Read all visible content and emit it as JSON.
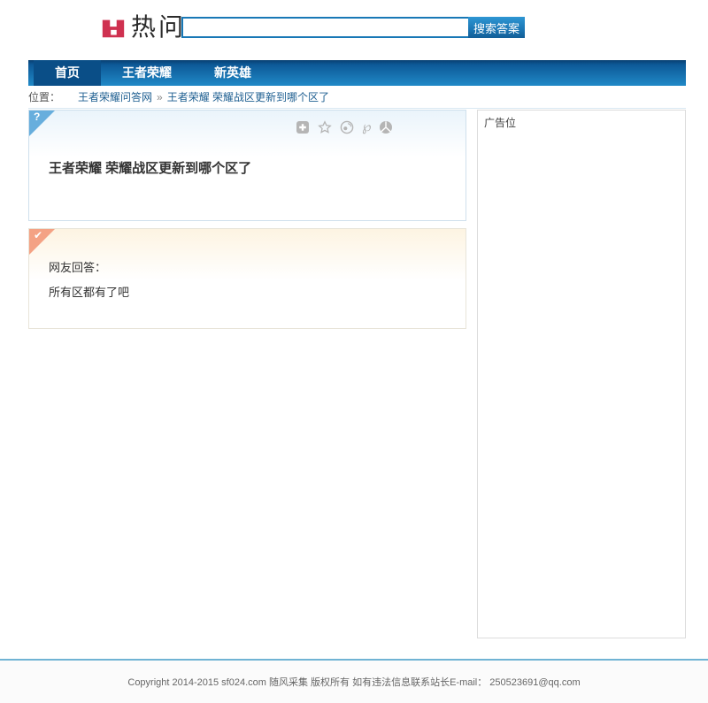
{
  "header": {
    "logo_text": "热问",
    "search_value": "",
    "search_button": "搜索答案"
  },
  "nav": {
    "items": [
      {
        "label": "首页",
        "active": true
      },
      {
        "label": "王者荣耀",
        "active": false
      },
      {
        "label": "新英雄",
        "active": false
      }
    ]
  },
  "breadcrumb": {
    "label": "位置：",
    "site": "王者荣耀问答网",
    "separator": "»",
    "current": "王者荣耀 荣耀战区更新到哪个区了"
  },
  "question": {
    "corner_glyph": "?",
    "title": "王者荣耀 荣耀战区更新到哪个区了",
    "share_icons": [
      "share-plus-icon",
      "favorite-star-icon",
      "sina-weibo-icon",
      "tencent-weibo-icon",
      "qzone-icon"
    ],
    "tencent_glyph": "℘"
  },
  "answer": {
    "corner_glyph": "✔",
    "heading": "网友回答：",
    "body": "所有区都有了吧"
  },
  "sidebar": {
    "ad_label": "广告位"
  },
  "footer": {
    "copyright": "Copyright 2014-2015 sf024.com 随风采集 版权所有 如有违法信息联系站长E-mail： 250523691@qq.com"
  },
  "colors": {
    "brand_red": "#cf3150",
    "accent_blue": "#1878b6",
    "nav_gradient_top": "#083f72",
    "nav_gradient_bottom": "#2089c7",
    "nav_active": "#0a4e87",
    "question_corner": "#67aedd",
    "answer_corner": "#f4a284",
    "question_tint": "#eaf4fb",
    "answer_tint": "#fdf4e2",
    "link_blue": "#1d5e90",
    "footer_line": "#70b3d4"
  }
}
